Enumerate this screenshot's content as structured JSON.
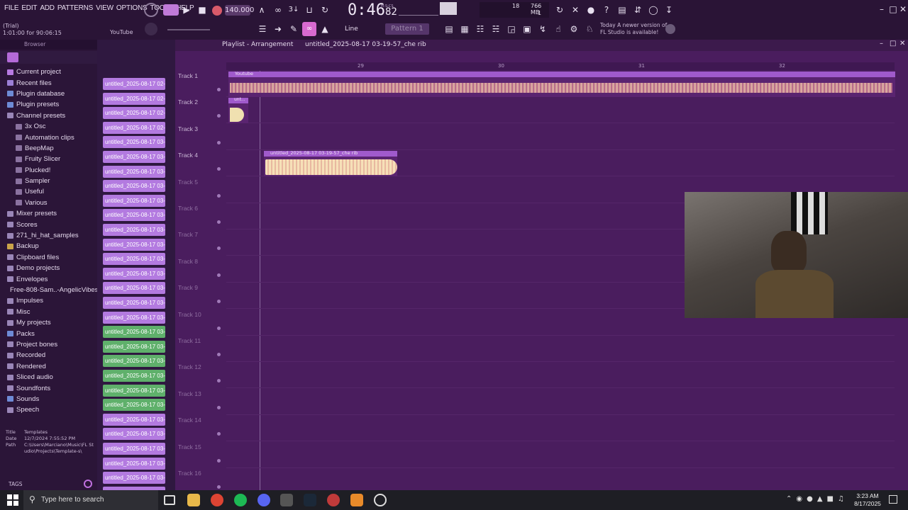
{
  "menu": [
    "FILE",
    "EDIT",
    "ADD",
    "PATTERNS",
    "VIEW",
    "OPTIONS",
    "TOOLS",
    "HELP"
  ],
  "hint": {
    "line1": "(Trial)",
    "line2": "1:01:00 for 90:06:15",
    "right": "YouTube"
  },
  "transport": {
    "tempo": "140.000",
    "time": "0:46",
    "time_small": "82",
    "time_label": "M:S:CS"
  },
  "stats": {
    "voices": "18",
    "cpu_line": "1",
    "memory": "766 MB"
  },
  "snap": "Line",
  "pattern": "Pattern 1",
  "news": {
    "line1": "Today  A newer version of",
    "line2": "FL Studio is available!"
  },
  "browser": {
    "title": "Browser",
    "items": [
      {
        "label": "Current project",
        "color": "#b77ae2"
      },
      {
        "label": "Recent files",
        "color": "#9c7fd6"
      },
      {
        "label": "Plugin database",
        "color": "#6e8bd6"
      },
      {
        "label": "Plugin presets",
        "color": "#6e8bd6"
      },
      {
        "label": "Channel presets",
        "color": "#9a86b8"
      },
      {
        "label": "3x Osc",
        "color": "#8a72a0",
        "indent": true
      },
      {
        "label": "Automation clips",
        "color": "#8a72a0",
        "indent": true
      },
      {
        "label": "BeepMap",
        "color": "#8a72a0",
        "indent": true
      },
      {
        "label": "Fruity Slicer",
        "color": "#8a72a0",
        "indent": true
      },
      {
        "label": "Plucked!",
        "color": "#8a72a0",
        "indent": true
      },
      {
        "label": "Sampler",
        "color": "#8a72a0",
        "indent": true
      },
      {
        "label": "Useful",
        "color": "#8a72a0",
        "indent": true
      },
      {
        "label": "Various",
        "color": "#8a72a0",
        "indent": true
      },
      {
        "label": "Mixer presets",
        "color": "#9a86b8"
      },
      {
        "label": "Scores",
        "color": "#9a86b8"
      },
      {
        "label": "271_hi_hat_samples",
        "color": "#9a86b8"
      },
      {
        "label": "Backup",
        "color": "#caa34a"
      },
      {
        "label": "Clipboard files",
        "color": "#9a86b8"
      },
      {
        "label": "Demo projects",
        "color": "#9a86b8"
      },
      {
        "label": "Envelopes",
        "color": "#9a86b8"
      },
      {
        "label": "Free-808-Sam..-AngelicVibes",
        "color": "#9a86b8"
      },
      {
        "label": "Impulses",
        "color": "#9a86b8"
      },
      {
        "label": "Misc",
        "color": "#9a86b8"
      },
      {
        "label": "My projects",
        "color": "#9a86b8"
      },
      {
        "label": "Packs",
        "color": "#6e8bd6"
      },
      {
        "label": "Project bones",
        "color": "#9a86b8"
      },
      {
        "label": "Recorded",
        "color": "#9a86b8"
      },
      {
        "label": "Rendered",
        "color": "#9a86b8"
      },
      {
        "label": "Sliced audio",
        "color": "#9a86b8"
      },
      {
        "label": "Soundfonts",
        "color": "#9a86b8"
      },
      {
        "label": "Sounds",
        "color": "#6e8bd6"
      },
      {
        "label": "Speech",
        "color": "#9a86b8"
      }
    ],
    "info": {
      "title_label": "Title",
      "title_val": "Templates",
      "date_label": "Date",
      "date_val": "12/7/2024 7:55:52 PM",
      "path_label": "Path",
      "path_val": "C:\\Users\\Marciano\\Music\\FL Studio\\Projects\\Template-s\\"
    },
    "tags": "TAGS"
  },
  "channels": [
    {
      "label": "untitled_2025-08-17 02-...",
      "green": false
    },
    {
      "label": "untitled_2025-08-17 02-...",
      "green": false
    },
    {
      "label": "untitled_2025-08-17 02-...",
      "green": false
    },
    {
      "label": "untitled_2025-08-17 02-...",
      "green": false
    },
    {
      "label": "untitled_2025-08-17 03-...",
      "green": false
    },
    {
      "label": "untitled_2025-08-17 03-...",
      "green": false
    },
    {
      "label": "untitled_2025-08-17 03-...",
      "green": false
    },
    {
      "label": "untitled_2025-08-17 03-...",
      "green": false
    },
    {
      "label": "untitled_2025-08-17 03-...",
      "green": false
    },
    {
      "label": "untitled_2025-08-17 03-...",
      "green": false
    },
    {
      "label": "untitled_2025-08-17 03-...",
      "green": false
    },
    {
      "label": "untitled_2025-08-17 03-...",
      "green": false
    },
    {
      "label": "untitled_2025-08-17 03-...",
      "green": false
    },
    {
      "label": "untitled_2025-08-17 03-...",
      "green": false
    },
    {
      "label": "untitled_2025-08-17 03-...",
      "green": false
    },
    {
      "label": "untitled_2025-08-17 03-...",
      "green": false
    },
    {
      "label": "untitled_2025-08-17 03-...",
      "green": false
    },
    {
      "label": "untitled_2025-08-17 03-...",
      "green": true
    },
    {
      "label": "untitled_2025-08-17 03-...",
      "green": true
    },
    {
      "label": "untitled_2025-08-17 03-...",
      "green": true
    },
    {
      "label": "untitled_2025-08-17 03-...",
      "green": true
    },
    {
      "label": "untitled_2025-08-17 03-...",
      "green": true
    },
    {
      "label": "untitled_2025-08-17 03-...",
      "green": true
    },
    {
      "label": "untitled_2025-08-17 03-...",
      "green": false
    },
    {
      "label": "untitled_2025-08-17 03-...",
      "green": false
    },
    {
      "label": "untitled_2025-08-17 03-...",
      "green": false
    },
    {
      "label": "untitled_2025-08-17 03-...",
      "green": false
    },
    {
      "label": "untitled_2025-08-17 03-...",
      "green": false
    },
    {
      "label": "untitled_2025-08-17 03-...",
      "green": false
    }
  ],
  "playlist": {
    "breadcrumb": "Playlist - Arrangement",
    "project": "untitled_2025-08-17 03-19-57_che rib",
    "ruler": [
      "29",
      "30",
      "31",
      "32"
    ],
    "tracks": [
      "Track 1",
      "Track 2",
      "Track 3",
      "Track 4",
      "Track 5",
      "Track 6",
      "Track 7",
      "Track 8",
      "Track 9",
      "Track 10",
      "Track 11",
      "Track 12",
      "Track 13",
      "Track 14",
      "Track 15",
      "Track 16"
    ],
    "clip1": "Youtube",
    "clip2": "unt...",
    "clip3": "untitled_2025-08-17 03-19-57_che rib"
  },
  "taskbar": {
    "search": "Type here to search",
    "time": "3:23 AM",
    "date": "8/17/2025"
  }
}
